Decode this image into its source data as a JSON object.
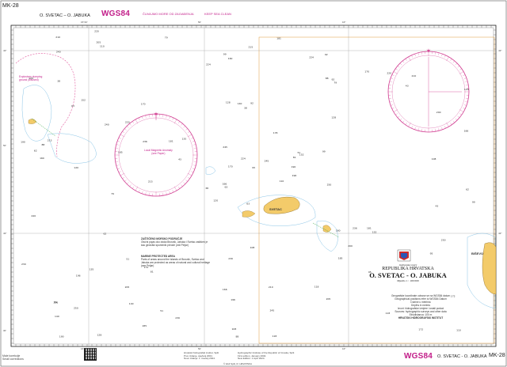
{
  "header": {
    "side_title": "MK-28",
    "left_title": "O. SVETAC – O. JABUKA",
    "datum": "WGS84",
    "keep_clean_hr": "ČUVAJMO MORE OD ZAGAĐENJA",
    "keep_clean_en": "KEEP SEA CLEAN"
  },
  "footer": {
    "small_corrections_1": "Male korekcije",
    "small_corrections_2": "Small corrections",
    "datum": "WGS84",
    "title": "O. SVETAC - O. JABUKA",
    "chart_number": "MK-28",
    "publisher_line_1": "Hrvatski hidrografski institut, Split",
    "publisher_line_2": "Prvo izdanje, siječanj 2004.",
    "publisher_line_3": "Novo izdanje: 1. travanj 2024.",
    "publisher_en_1": "Hydrographic Institute of the Republic of Croatia, Split",
    "publisher_en_2": "First edition, January 2004.",
    "publisher_en_3": "New Edition: 1 April 2024.",
    "copyright": "© HHI Split, R. HRVATSKA"
  },
  "map": {
    "sea_area": "Jadransko more",
    "republic": "REPUBLIKA HRVATSKA",
    "chart_name": "O. SVETAC - O. JABUKA",
    "scale": "Mjerilo 1 : 100 000",
    "publisher": "HRVATSKI HIDROGRAFSKI INSTITUT",
    "island_svetac": "SVETAC",
    "island_bisevo": "BIŠEVO",
    "island_palagruza_label": "Ple Jabuka",
    "explosives_label_1": "Explosives dumping",
    "explosives_label_2": "ground (disused)",
    "magnetic_label_1": "Local Magnetic Anomaly",
    "magnetic_label_2": "(see Paper)",
    "protected_hr_title": "ZAŠTIĆENO MORSKO PODRUČJE",
    "protected_hr_body": "Otočni pojas oko otoka Brusnik, Jabuka i Svetac zaštićen je kao geološki spomenik prirode (vidi Peljar)",
    "protected_en_title": "MARINE PROTECTED AREA",
    "protected_en_body": "Parts of areas around the islands of Brusnik, Svetac and Jabuka are protected as areas of natural and cultural heritage (see Peljar)",
    "latitudes": [
      "43°",
      "50'",
      "40'",
      "43°",
      "30'",
      "20'",
      "10'"
    ],
    "longitudes": [
      "16°",
      "15°40'",
      "50'",
      "15°"
    ],
    "datum_note_1": "Geografske koordinate odnose se na WGS84 datum",
    "datum_note_2": "Geographical positions refer to WGS84 Datum",
    "depth_note_1": "Dubine u metrima",
    "depth_note_2": "Depths in metres",
    "sources_1": "Izvori: hidrografske izmjere i ostali podaci",
    "sources_2": "Sources: hydrographic surveys and other data",
    "edition_note": "Ekvidistanca: 100 m"
  },
  "soundings": [
    "63",
    "81",
    "92",
    "110",
    "120",
    "128",
    "135",
    "140",
    "152",
    "160",
    "166",
    "170",
    "172",
    "181",
    "185",
    "190",
    "196",
    "200",
    "205",
    "210",
    "215",
    "220",
    "224",
    "230",
    "236",
    "240",
    "245",
    "250",
    "108",
    "118",
    "99",
    "95",
    "88",
    "79",
    "62",
    "51",
    "43",
    "38"
  ]
}
